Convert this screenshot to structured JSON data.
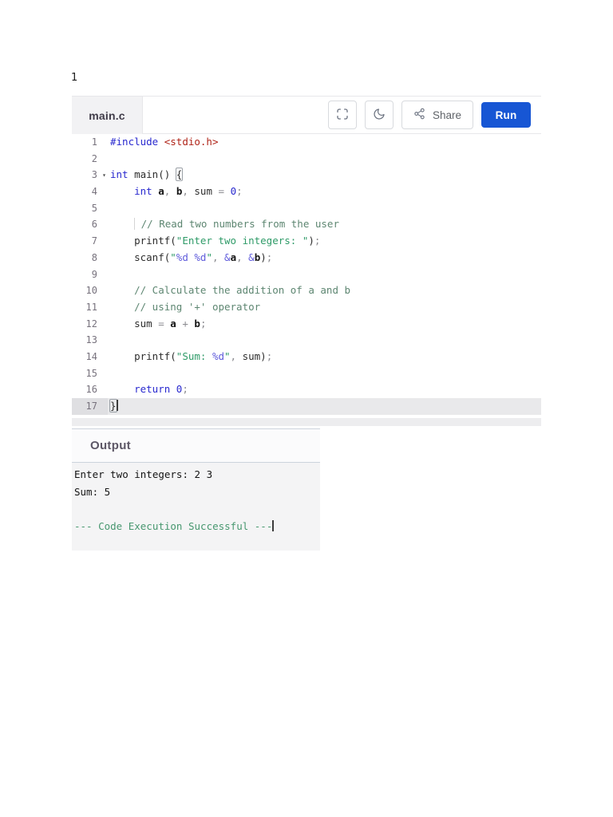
{
  "page": {
    "number": "1"
  },
  "ide": {
    "tab_label": "main.c",
    "toolbar": {
      "fullscreen_icon": "fullscreen-icon",
      "theme_icon": "moon-icon",
      "share_icon": "share-nodes-icon",
      "share_label": "Share",
      "run_label": "Run"
    },
    "colors": {
      "run_button": "#1756d4",
      "keyword": "#2929cf",
      "include_path": "#b02418",
      "string": "#2f9b68",
      "format_specifier": "#5f5bdb",
      "comment": "#5d8671",
      "active_line": "#e9e9eb",
      "success_text": "#47976f"
    },
    "code": {
      "language": "c",
      "lines": [
        {
          "n": "1",
          "tokens": [
            [
              "kw",
              "#include"
            ],
            [
              "pl",
              " "
            ],
            [
              "inc",
              "<stdio.h>"
            ]
          ]
        },
        {
          "n": "2",
          "tokens": []
        },
        {
          "n": "3",
          "fold": true,
          "tokens": [
            [
              "kw",
              "int"
            ],
            [
              "pl",
              " main() "
            ],
            [
              "brkt",
              "{"
            ]
          ]
        },
        {
          "n": "4",
          "tokens": [
            [
              "pl",
              "    "
            ],
            [
              "kw",
              "int"
            ],
            [
              "pl",
              " "
            ],
            [
              "var",
              "a"
            ],
            [
              "op",
              ","
            ],
            [
              "pl",
              " "
            ],
            [
              "var",
              "b"
            ],
            [
              "op",
              ","
            ],
            [
              "pl",
              " sum "
            ],
            [
              "op",
              "="
            ],
            [
              "pl",
              " "
            ],
            [
              "num",
              "0"
            ],
            [
              "op",
              ";"
            ]
          ]
        },
        {
          "n": "5",
          "tokens": []
        },
        {
          "n": "6",
          "tokens": [
            [
              "guide",
              "    "
            ],
            [
              "com",
              " // Read two numbers from the user"
            ]
          ]
        },
        {
          "n": "7",
          "tokens": [
            [
              "pl",
              "    printf("
            ],
            [
              "str",
              "\"Enter two integers: \""
            ],
            [
              "pl",
              ")"
            ],
            [
              "op",
              ";"
            ]
          ]
        },
        {
          "n": "8",
          "tokens": [
            [
              "pl",
              "    scanf("
            ],
            [
              "str",
              "\""
            ],
            [
              "fmt",
              "%d"
            ],
            [
              "str",
              " "
            ],
            [
              "fmt",
              "%d"
            ],
            [
              "str",
              "\""
            ],
            [
              "op",
              ","
            ],
            [
              "pl",
              " "
            ],
            [
              "fmt",
              "&"
            ],
            [
              "var",
              "a"
            ],
            [
              "op",
              ","
            ],
            [
              "pl",
              " "
            ],
            [
              "fmt",
              "&"
            ],
            [
              "var",
              "b"
            ],
            [
              "pl",
              ")"
            ],
            [
              "op",
              ";"
            ]
          ]
        },
        {
          "n": "9",
          "tokens": []
        },
        {
          "n": "10",
          "tokens": [
            [
              "pl",
              "    "
            ],
            [
              "com",
              "// Calculate the addition of a and b"
            ]
          ]
        },
        {
          "n": "11",
          "tokens": [
            [
              "pl",
              "    "
            ],
            [
              "com",
              "// using '+' operator"
            ]
          ]
        },
        {
          "n": "12",
          "tokens": [
            [
              "pl",
              "    sum "
            ],
            [
              "op",
              "="
            ],
            [
              "pl",
              " "
            ],
            [
              "var",
              "a"
            ],
            [
              "pl",
              " "
            ],
            [
              "op",
              "+"
            ],
            [
              "pl",
              " "
            ],
            [
              "var",
              "b"
            ],
            [
              "op",
              ";"
            ]
          ]
        },
        {
          "n": "13",
          "tokens": []
        },
        {
          "n": "14",
          "tokens": [
            [
              "pl",
              "    printf("
            ],
            [
              "str",
              "\"Sum: "
            ],
            [
              "fmt",
              "%d"
            ],
            [
              "str",
              "\""
            ],
            [
              "op",
              ","
            ],
            [
              "pl",
              " sum)"
            ],
            [
              "op",
              ";"
            ]
          ]
        },
        {
          "n": "15",
          "tokens": []
        },
        {
          "n": "16",
          "tokens": [
            [
              "pl",
              "    "
            ],
            [
              "kw",
              "return"
            ],
            [
              "pl",
              " "
            ],
            [
              "num",
              "0"
            ],
            [
              "op",
              ";"
            ]
          ]
        },
        {
          "n": "17",
          "active": true,
          "cursor": true,
          "tokens": [
            [
              "brkt",
              "}"
            ]
          ]
        }
      ]
    }
  },
  "output": {
    "title": "Output",
    "lines": [
      "Enter two integers: 2 3",
      "Sum: 5",
      ""
    ],
    "status": "--- Code Execution Successful ---"
  }
}
